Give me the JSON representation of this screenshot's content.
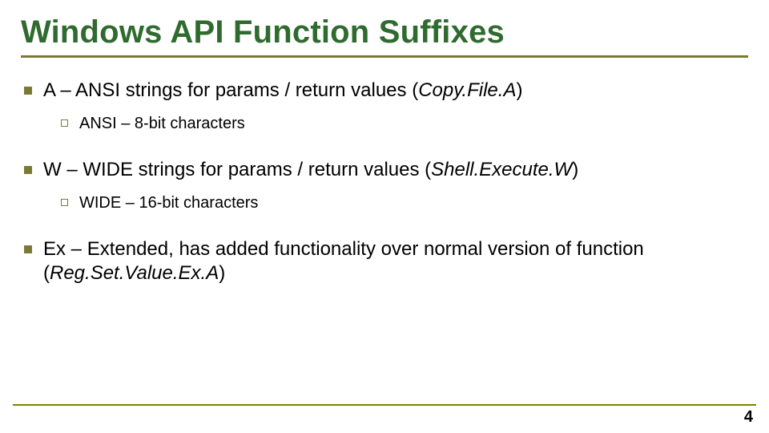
{
  "title": "Windows API Function Suffixes",
  "items": [
    {
      "main_pre": "A – ANSI strings for params / return values (",
      "main_italic": "Copy.File.A",
      "main_post": ")",
      "sub": "ANSI – 8-bit characters"
    },
    {
      "main_pre": "W – WIDE strings for params / return values (",
      "main_italic": "Shell.Execute.W",
      "main_post": ")",
      "sub": "WIDE – 16-bit characters"
    },
    {
      "main_pre": "Ex – Extended, has added functionality over normal version of function (",
      "main_italic": "Reg.Set.Value.Ex.A",
      "main_post": ")",
      "sub": null
    }
  ],
  "page_number": "4"
}
